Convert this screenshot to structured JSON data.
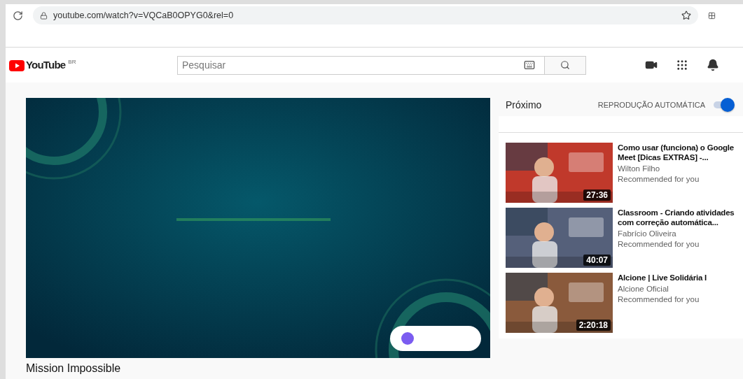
{
  "browser": {
    "url": "youtube.com/watch?v=VQCaB0OPYG0&rel=0"
  },
  "header": {
    "logo": "YouTube",
    "region": "BR",
    "search": {
      "placeholder": "Pesquisar"
    }
  },
  "video": {
    "kind": "picture",
    "title": "Mission Impossible"
  },
  "up_next": {
    "heading": "Próximo",
    "autoplay": {
      "label": "REPRODUÇÃO AUTOMÁTICA",
      "on": true
    }
  },
  "recommendations": [
    {
      "title": "Como usar (funciona) o Google Meet [Dicas EXTRAS] -...",
      "channel": "Wilton Filho",
      "note": "Recommended for you",
      "duration": "27:36",
      "color": "#c0392b"
    },
    {
      "title": "Classroom - Criando atividades com correção automática...",
      "channel": "Fabrício Oliveira",
      "note": "Recommended for you",
      "duration": "40:07",
      "color": "#55607a"
    },
    {
      "title": "Alcione | Live Solidária I",
      "channel": "Alcione Oficial",
      "note": "Recommended for you",
      "duration": "2:20:18",
      "color": "#8a5a3c"
    }
  ]
}
